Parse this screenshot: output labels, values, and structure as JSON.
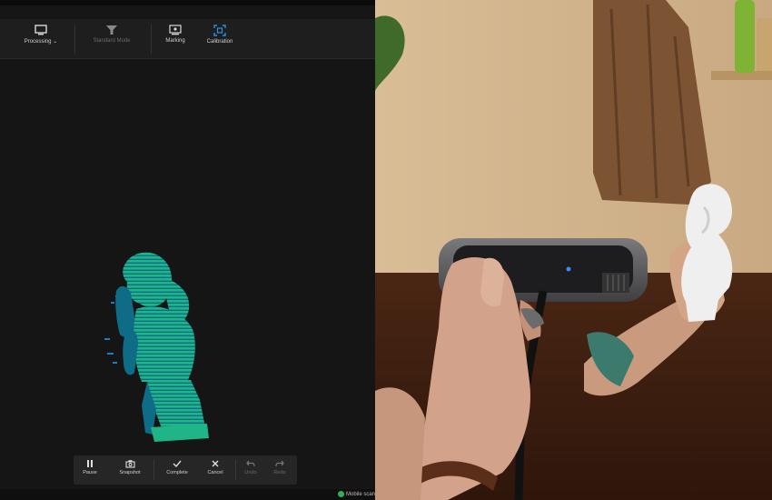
{
  "toolbar": {
    "items": [
      {
        "label": "Processing",
        "icon": "monitor-icon",
        "has_dropdown": true,
        "enabled": true
      },
      {
        "label": "Standard Mode",
        "icon": "funnel-icon",
        "enabled": false
      },
      {
        "label": "Marking",
        "icon": "screen-marker-icon",
        "enabled": true
      },
      {
        "label": "Calibration",
        "icon": "calibration-frame-icon",
        "enabled": true
      }
    ]
  },
  "viewport": {
    "content": "point-cloud-bust",
    "colors": {
      "main": "#1fb586",
      "shade": "#0e6c87",
      "scatter": "#1a7fc4"
    }
  },
  "scan_controls": {
    "items": [
      {
        "label": "Pause",
        "icon": "pause-icon",
        "enabled": true
      },
      {
        "label": "Snapshot",
        "icon": "camera-icon",
        "enabled": true
      },
      {
        "label": "Complete",
        "icon": "check-icon",
        "enabled": true
      },
      {
        "label": "Cancel",
        "icon": "close-icon",
        "enabled": true
      },
      {
        "label": "Undo",
        "icon": "undo-arrow-icon",
        "enabled": false
      },
      {
        "label": "Redo",
        "icon": "redo-arrow-icon",
        "enabled": false
      }
    ]
  },
  "status": {
    "text": "Mobile scan",
    "ok_color": "#2eb05a"
  },
  "photo": {
    "description_colors": {
      "wall": "#d3b48c",
      "table": "#3e1f10",
      "scanner": "#5c5c5e",
      "statue": "#eeeeee"
    }
  }
}
